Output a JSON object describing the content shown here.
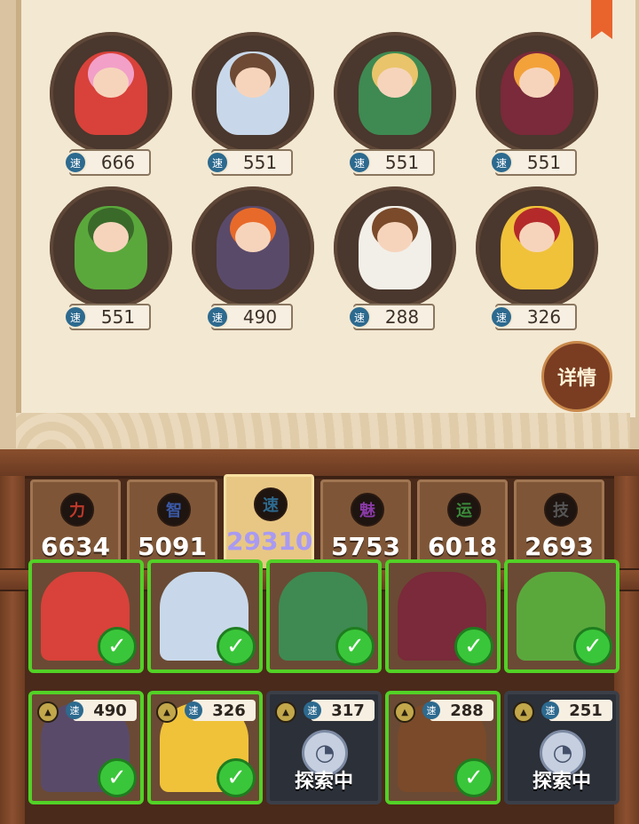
{
  "roster": {
    "speed_icon": "速",
    "heroes": [
      {
        "speed": "666",
        "color": "#d8423a",
        "accent": "#f2a0c8"
      },
      {
        "speed": "551",
        "color": "#c8d8ea",
        "accent": "#6e4a34"
      },
      {
        "speed": "551",
        "color": "#3e8a52",
        "accent": "#e9c46a"
      },
      {
        "speed": "551",
        "color": "#7a2a3a",
        "accent": "#f3a23a"
      },
      {
        "speed": "551",
        "color": "#5aa83c",
        "accent": "#3a6a2a"
      },
      {
        "speed": "490",
        "color": "#5a4a6a",
        "accent": "#e86a2a"
      },
      {
        "speed": "288",
        "color": "#f2efe8",
        "accent": "#7a4a2a"
      },
      {
        "speed": "326",
        "color": "#f0c23a",
        "accent": "#b42a2a"
      }
    ]
  },
  "details_button": "详情",
  "stats": [
    {
      "icon": "力",
      "value": "6634",
      "color": "#c0392b"
    },
    {
      "icon": "智",
      "value": "5091",
      "color": "#3a5aa8"
    },
    {
      "icon": "速",
      "value": "29310",
      "color": "#2d6a8f"
    },
    {
      "icon": "魅",
      "value": "5753",
      "color": "#8a3aa8"
    },
    {
      "icon": "运",
      "value": "6018",
      "color": "#3a8a3a"
    },
    {
      "icon": "技",
      "value": "2693",
      "color": "#555555"
    }
  ],
  "team": {
    "check": "✓",
    "tier_icon": "▲",
    "speed_icon": "速",
    "busy_label": "探索中",
    "clock_icon": "◔",
    "row1": [
      {
        "color": "#d8423a"
      },
      {
        "color": "#c8d8ea"
      },
      {
        "color": "#3e8a52"
      },
      {
        "color": "#7a2a3a"
      },
      {
        "color": "#5aa83c"
      }
    ],
    "row2": [
      {
        "speed": "490",
        "busy": false,
        "color": "#5a4a6a"
      },
      {
        "speed": "326",
        "busy": false,
        "color": "#f0c23a"
      },
      {
        "speed": "317",
        "busy": true,
        "color": "#2c3038"
      },
      {
        "speed": "288",
        "busy": false,
        "color": "#7a4a2a"
      },
      {
        "speed": "251",
        "busy": true,
        "color": "#2c3038"
      }
    ]
  }
}
